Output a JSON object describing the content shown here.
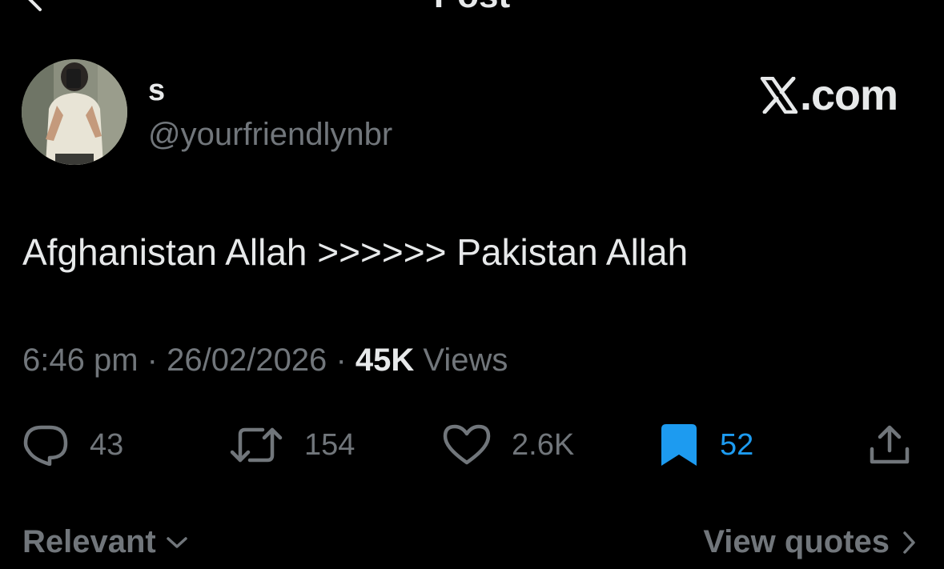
{
  "header": {
    "title": "Post",
    "back_icon": "arrow-left-icon"
  },
  "post": {
    "author": {
      "display_name": "s",
      "handle": "@yourfriendlynbr"
    },
    "brand": {
      "label": ".com",
      "icon": "x-logo-icon"
    },
    "text": "Afghanistan Allah >>>>>> Pakistan Allah",
    "meta": {
      "time": "6:46 pm",
      "separator": "·",
      "date": "26/02/2026",
      "views_count": "45K",
      "views_label": "Views"
    },
    "actions": {
      "replies": "43",
      "reposts": "154",
      "likes": "2.6K",
      "bookmarks": "52",
      "share_icon": "share-icon"
    },
    "colors": {
      "background": "#000000",
      "text": "#e7e9ea",
      "secondary": "#71767b",
      "accent": "#1d9bf0"
    }
  },
  "footer": {
    "sort_label": "Relevant",
    "quotes_label": "View quotes"
  }
}
